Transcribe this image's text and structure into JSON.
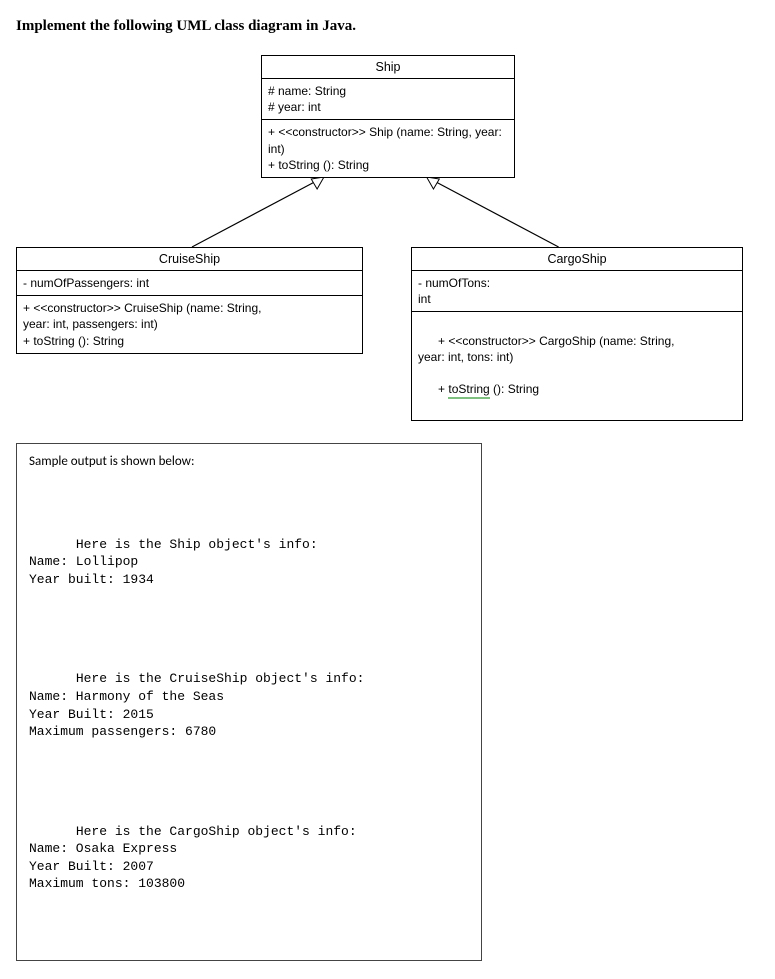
{
  "heading": "Implement the following UML class diagram in Java.",
  "uml": {
    "ship": {
      "title": "Ship",
      "attrs": "# name: String\n# year: int",
      "ops": "+ <<constructor>> Ship (name: String, year:\nint)\n+ toString (): String"
    },
    "cruise": {
      "title": "CruiseShip",
      "attrs": "- numOfPassengers: int",
      "ops": "+ <<constructor>> CruiseShip (name: String,\nyear: int, passengers: int)\n+ toString (): String"
    },
    "cargo": {
      "title": "CargoShip",
      "attrs": "- numOfTons:\nint",
      "ops_ctor": "+ <<constructor>> CargoShip (name: String,\nyear: int, tons: int)",
      "ops_tostr_prefix": "+ ",
      "ops_tostr_mid": "toString",
      "ops_tostr_suffix": " (): String"
    }
  },
  "output": {
    "caption": "Sample output is shown below:",
    "block1_l1": "Here is the Ship object's info:",
    "block1_l2": "Name: Lollipop",
    "block1_l3": "Year built: 1934",
    "block2_l1": "Here is the CruiseShip object's info:",
    "block2_l2": "Name: Harmony of the Seas",
    "block2_l3": "Year Built: 2015",
    "block2_l4": "Maximum passengers: 6780",
    "block3_l1": "Here is the CargoShip object's info:",
    "block3_l2": "Name: Osaka Express",
    "block3_l3": "Year Built: 2007",
    "block3_l4": "Maximum tons: 103800"
  }
}
